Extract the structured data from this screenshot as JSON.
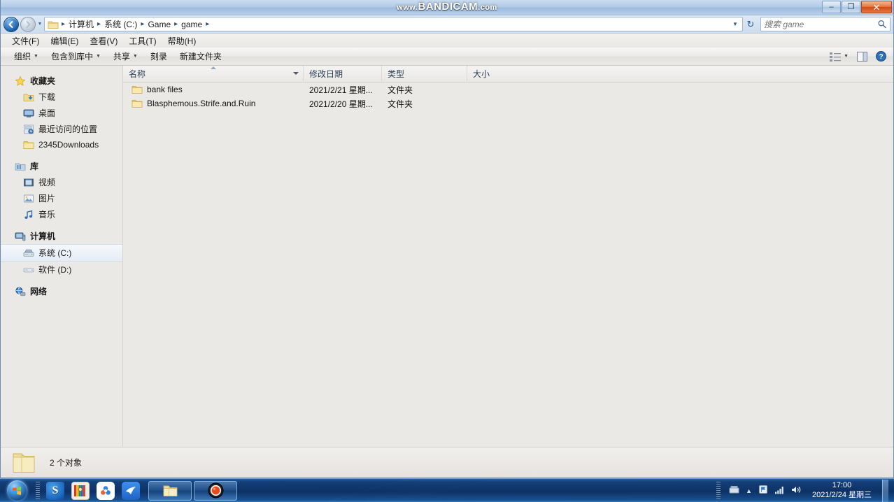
{
  "watermark": {
    "prefix": "www.",
    "brand": "BANDICAM",
    "suffix": ".com"
  },
  "window": {
    "minimize_label": "–",
    "maximize_label": "❐",
    "close_label": "✕"
  },
  "address": {
    "back_label": "←",
    "forward_label": "→",
    "history_caret": "▼",
    "folder_icon": "folder-icon",
    "crumbs": [
      "计算机",
      "系统 (C:)",
      "Game",
      "game"
    ],
    "separator": "▸",
    "dropdown_caret": "▼",
    "refresh_label": "↻"
  },
  "search": {
    "placeholder": "搜索 game",
    "value": "",
    "icon": "🔍"
  },
  "menu": {
    "items": [
      "文件(F)",
      "编辑(E)",
      "查看(V)",
      "工具(T)",
      "帮助(H)"
    ]
  },
  "commandbar": {
    "items": [
      {
        "label": "组织",
        "caret": true
      },
      {
        "label": "包含到库中",
        "caret": true
      },
      {
        "label": "共享",
        "caret": true
      },
      {
        "label": "刻录",
        "caret": false
      },
      {
        "label": "新建文件夹",
        "caret": false
      }
    ],
    "view_caret": "▼",
    "view_icon": "view-options-icon",
    "preview_icon": "preview-pane-icon",
    "help_icon": "help-icon",
    "help_label": "?"
  },
  "sidebar": {
    "groups": [
      {
        "head": {
          "label": "收藏夹",
          "icon": "star-icon"
        },
        "items": [
          {
            "label": "下载",
            "icon": "downloads-icon"
          },
          {
            "label": "桌面",
            "icon": "desktop-icon"
          },
          {
            "label": "最近访问的位置",
            "icon": "recent-places-icon"
          },
          {
            "label": "2345Downloads",
            "icon": "folder-icon"
          }
        ]
      },
      {
        "head": {
          "label": "库",
          "icon": "library-icon"
        },
        "items": [
          {
            "label": "视频",
            "icon": "video-icon"
          },
          {
            "label": "图片",
            "icon": "pictures-icon"
          },
          {
            "label": "音乐",
            "icon": "music-icon"
          }
        ]
      },
      {
        "head": {
          "label": "计算机",
          "icon": "computer-icon"
        },
        "items": [
          {
            "label": "系统 (C:)",
            "icon": "hard-drive-icon",
            "selected": true
          },
          {
            "label": "软件 (D:)",
            "icon": "drive-icon",
            "selected": false
          }
        ]
      },
      {
        "head": {
          "label": "网络",
          "icon": "network-icon"
        },
        "items": []
      }
    ]
  },
  "filelist": {
    "columns": [
      {
        "key": "name",
        "label": "名称",
        "sorted": "asc"
      },
      {
        "key": "date",
        "label": "修改日期"
      },
      {
        "key": "type",
        "label": "类型"
      },
      {
        "key": "size",
        "label": "大小"
      }
    ],
    "rows": [
      {
        "icon": "folder-icon",
        "name": "bank files",
        "date": "2021/2/21 星期...",
        "type": "文件夹",
        "size": ""
      },
      {
        "icon": "folder-icon",
        "name": "Blasphemous.Strife.and.Ruin",
        "date": "2021/2/20 星期...",
        "type": "文件夹",
        "size": ""
      }
    ]
  },
  "statusbar": {
    "icon": "folder-icon",
    "text": "2 个对象"
  },
  "taskbar": {
    "start_label": "start-orb",
    "quicklaunch": [
      {
        "name": "sogou-browser-icon",
        "glyph": "S",
        "color": "#1a6fc4"
      },
      {
        "name": "winrar-icon",
        "glyph": "",
        "color": "#b9402a"
      },
      {
        "name": "cloud-app-icon",
        "glyph": "",
        "color": "#ffffff"
      },
      {
        "name": "foxmail-bird-icon",
        "glyph": "",
        "color": "#1e6fd9"
      }
    ],
    "buttons": [
      {
        "name": "taskbar-explorer-button",
        "icon": "folder-icon",
        "active": true
      },
      {
        "name": "taskbar-bandicam-button",
        "icon": "record-icon",
        "active": false
      }
    ],
    "tray": {
      "icons": [
        "tray-app-icon",
        "tray-expand-icon",
        "tray-update-icon",
        "network-signal-icon",
        "volume-icon"
      ],
      "expand_glyph": "▲",
      "time": "17:00",
      "date": "2021/2/24 星期三"
    }
  },
  "colors": {
    "window_bg": "#ebe9e6",
    "taskbar_blue": "#12407f",
    "accent": "#2a6bb5",
    "folder_yellow": "#f0d98c"
  }
}
